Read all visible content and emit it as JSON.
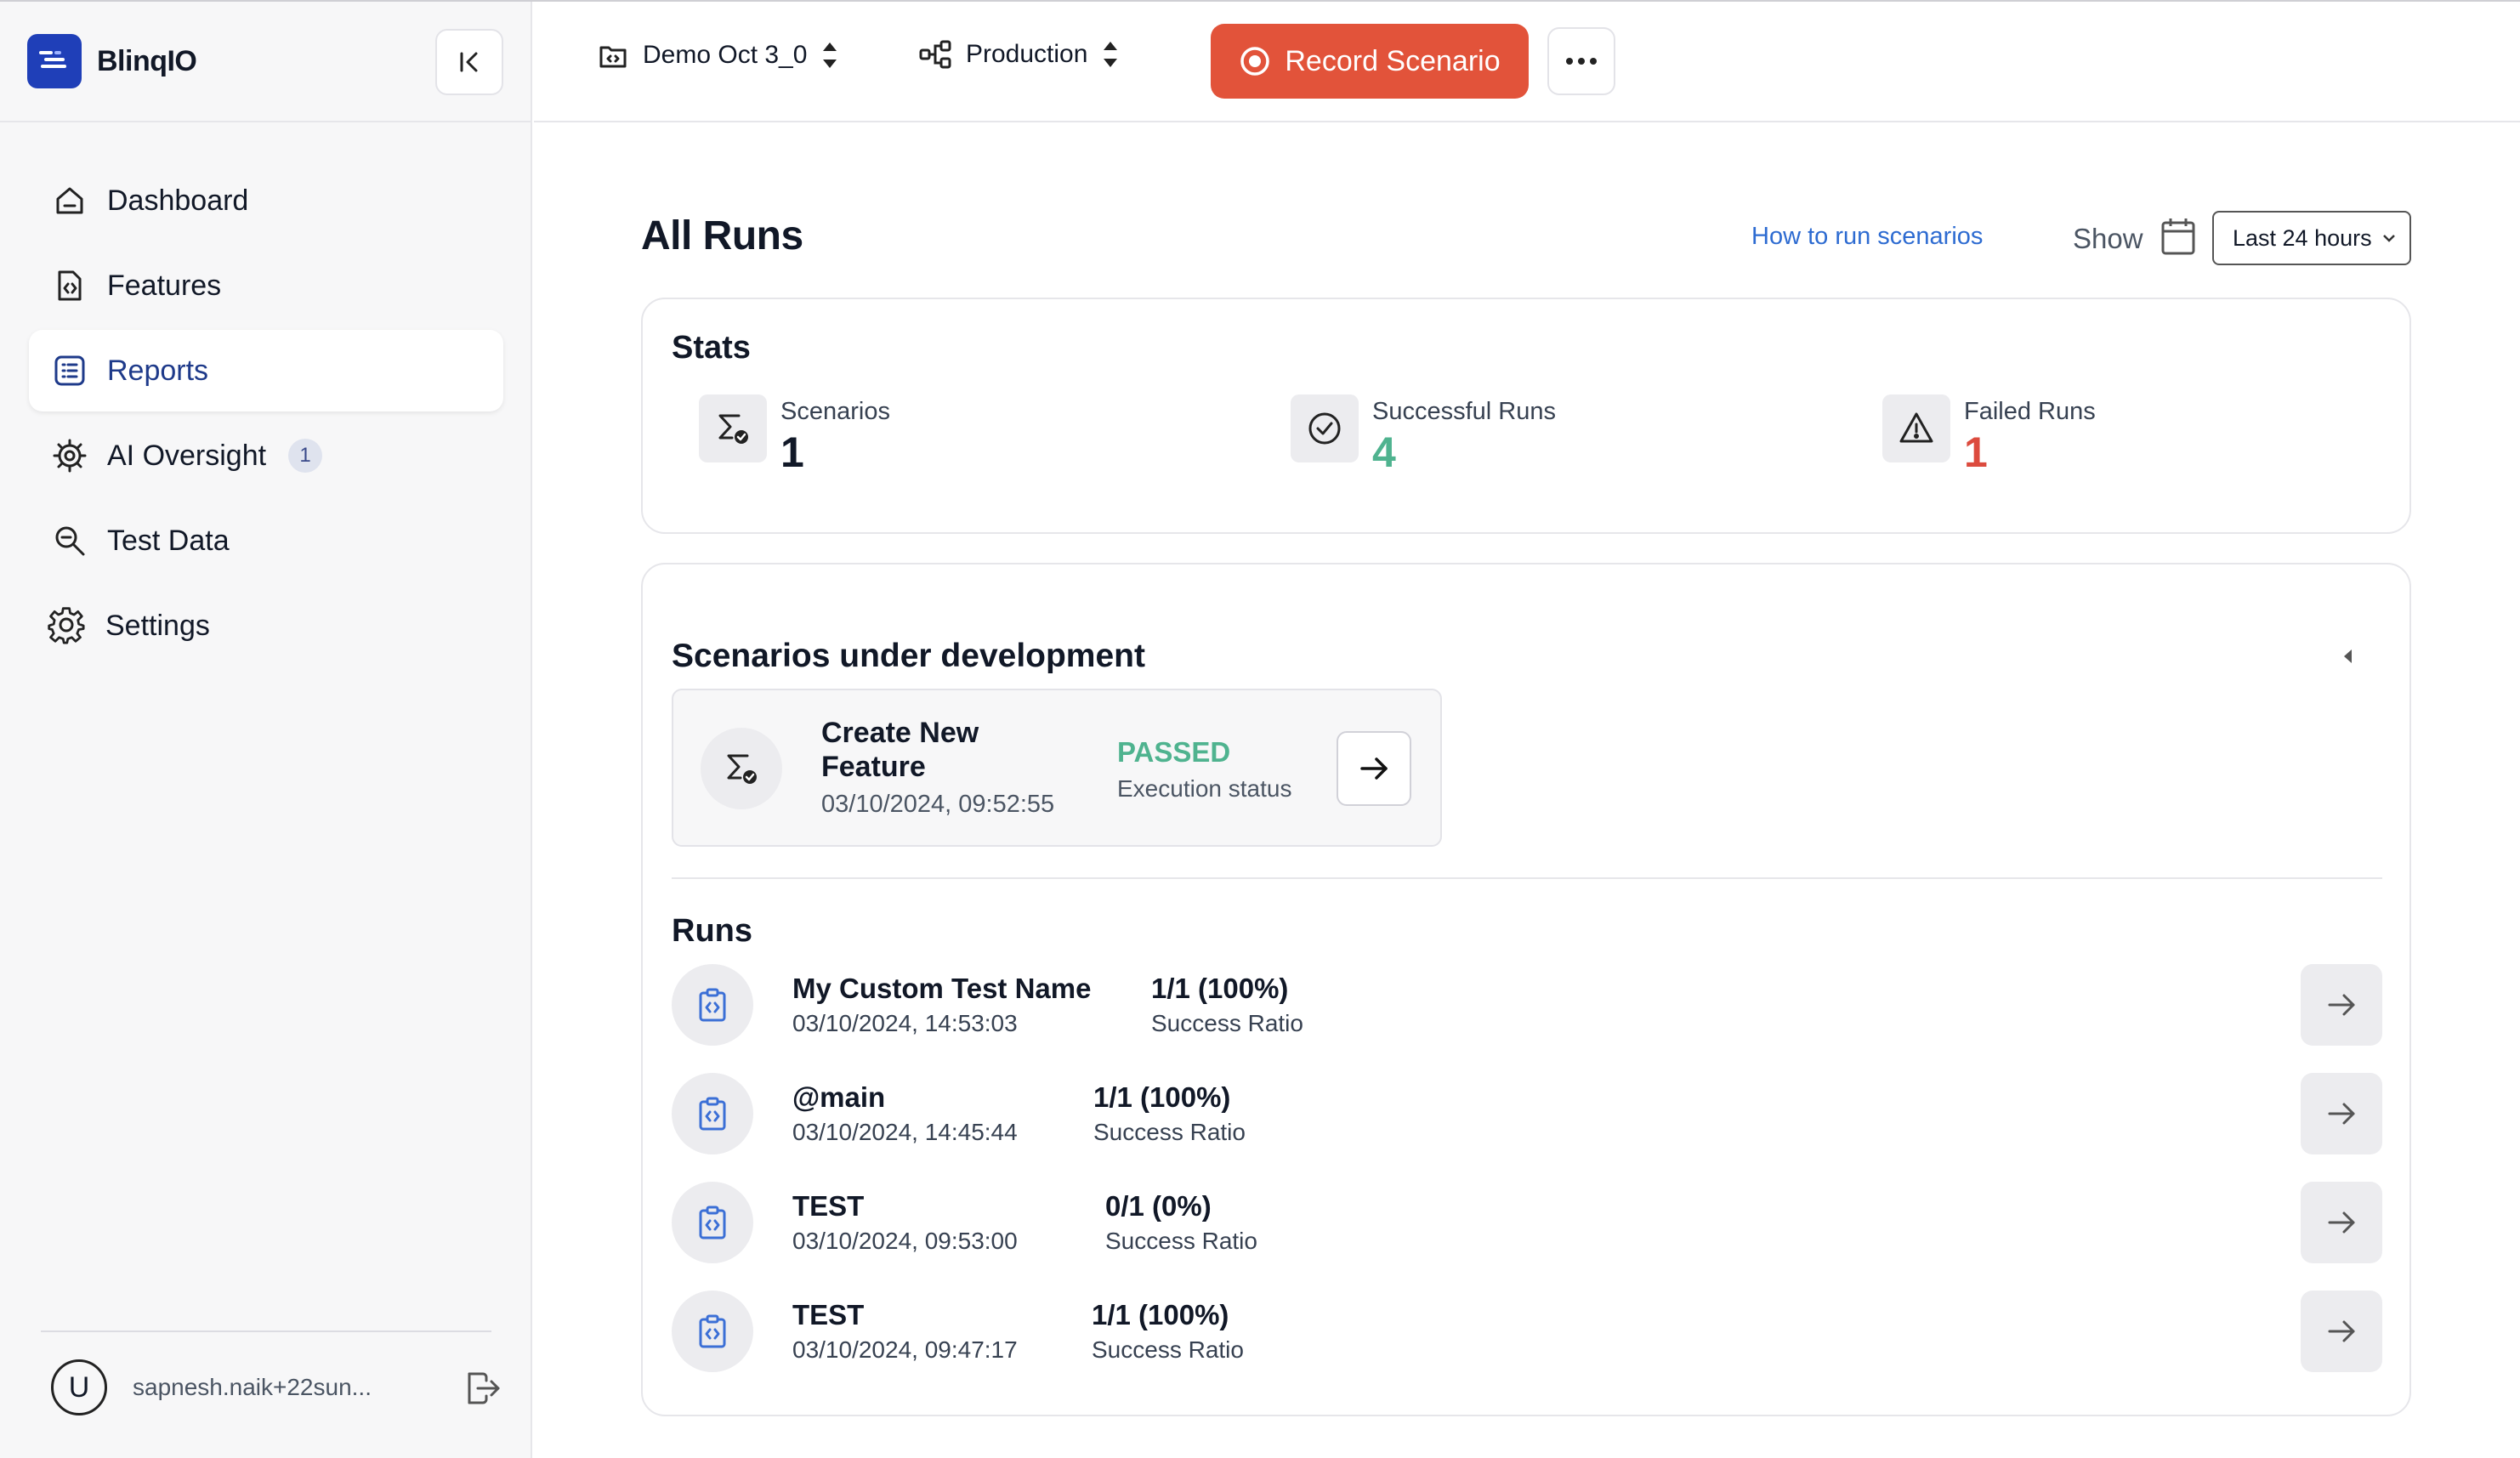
{
  "brand": {
    "name": "BlinqIO"
  },
  "sidebar": {
    "items": [
      {
        "label": "Dashboard",
        "icon": "home-icon",
        "active": false
      },
      {
        "label": "Features",
        "icon": "file-code-icon",
        "active": false
      },
      {
        "label": "Reports",
        "icon": "list-icon",
        "active": true
      },
      {
        "label": "AI Oversight",
        "icon": "ai-chip-icon",
        "active": false,
        "badge": "1"
      },
      {
        "label": "Test Data",
        "icon": "magnifier-icon",
        "active": false
      },
      {
        "label": "Settings",
        "icon": "gear-icon",
        "active": false
      }
    ],
    "user": {
      "avatar_letter": "U",
      "email": "sapnesh.naik+22sun..."
    }
  },
  "topbar": {
    "project": "Demo Oct 3_0",
    "environment": "Production",
    "record_label": "Record Scenario"
  },
  "main": {
    "title": "All Runs",
    "help_link": "How to run scenarios",
    "show_label": "Show",
    "range": "Last 24 hours"
  },
  "stats": {
    "title": "Stats",
    "items": [
      {
        "label": "Scenarios",
        "value": "1",
        "color": "#111827"
      },
      {
        "label": "Successful Runs",
        "value": "4",
        "color": "#4fb38f"
      },
      {
        "label": "Failed Runs",
        "value": "1",
        "color": "#dc4b3e"
      }
    ]
  },
  "dev": {
    "title": "Scenarios under development",
    "scenario": {
      "name": "Create New Feature",
      "date": "03/10/2024, 09:52:55",
      "status": "PASSED",
      "status_label": "Execution status"
    }
  },
  "runs": {
    "title": "Runs",
    "items": [
      {
        "name": "My Custom Test Name",
        "date": "03/10/2024, 14:53:03",
        "ratio": "1/1 (100%)",
        "ratio_label": "Success Ratio"
      },
      {
        "name": "@main",
        "date": "03/10/2024, 14:45:44",
        "ratio": "1/1 (100%)",
        "ratio_label": "Success Ratio"
      },
      {
        "name": "TEST",
        "date": "03/10/2024, 09:53:00",
        "ratio": "0/1 (0%)",
        "ratio_label": "Success Ratio"
      },
      {
        "name": "TEST",
        "date": "03/10/2024, 09:47:17",
        "ratio": "1/1 (100%)",
        "ratio_label": "Success Ratio"
      }
    ]
  },
  "colors": {
    "accent": "#e2533a",
    "brand": "#1f3fb8",
    "link": "#2d6bd1",
    "success": "#4fb38f",
    "danger": "#dc4b3e"
  }
}
